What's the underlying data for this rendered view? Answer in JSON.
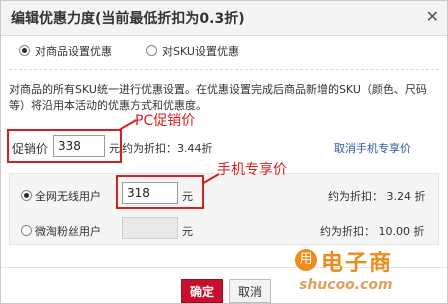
{
  "dialog": {
    "title": "编辑优惠力度(当前最低折扣为0.3折)",
    "close_glyph": "✕"
  },
  "options": {
    "by_product_label": "对商品设置优惠",
    "by_sku_label": "对SKU设置优惠"
  },
  "description": "对商品的所有SKU统一进行优惠设置。在优惠设置完成后商品新增的SKU（颜色、尺码等）将沿用本活动的优惠方式和优惠度。",
  "pc": {
    "annotation": "PC促销价",
    "price_label": "促销价",
    "price_value": "338",
    "unit": "元",
    "discount_text": "约为折扣：3.44折",
    "cancel_mobile_link": "取消手机专享价"
  },
  "mobile": {
    "annotation": "手机专享价",
    "rows": [
      {
        "label": "全网无线用户",
        "value": "318",
        "unit": "元",
        "discount_text": "约为折扣： 3.24 折"
      },
      {
        "label": "微淘粉丝用户",
        "value": "",
        "unit": "元",
        "discount_text": "约为折扣： 10.00 折"
      }
    ]
  },
  "buttons": {
    "ok": "确定",
    "cancel": "取消"
  },
  "watermark": {
    "icon_text": "用",
    "big": "电子商",
    "small": "shucoo.com"
  },
  "colors": {
    "accent": "#c8102e",
    "annotation_red": "#d61f1f",
    "link_blue": "#2a5aa8"
  }
}
